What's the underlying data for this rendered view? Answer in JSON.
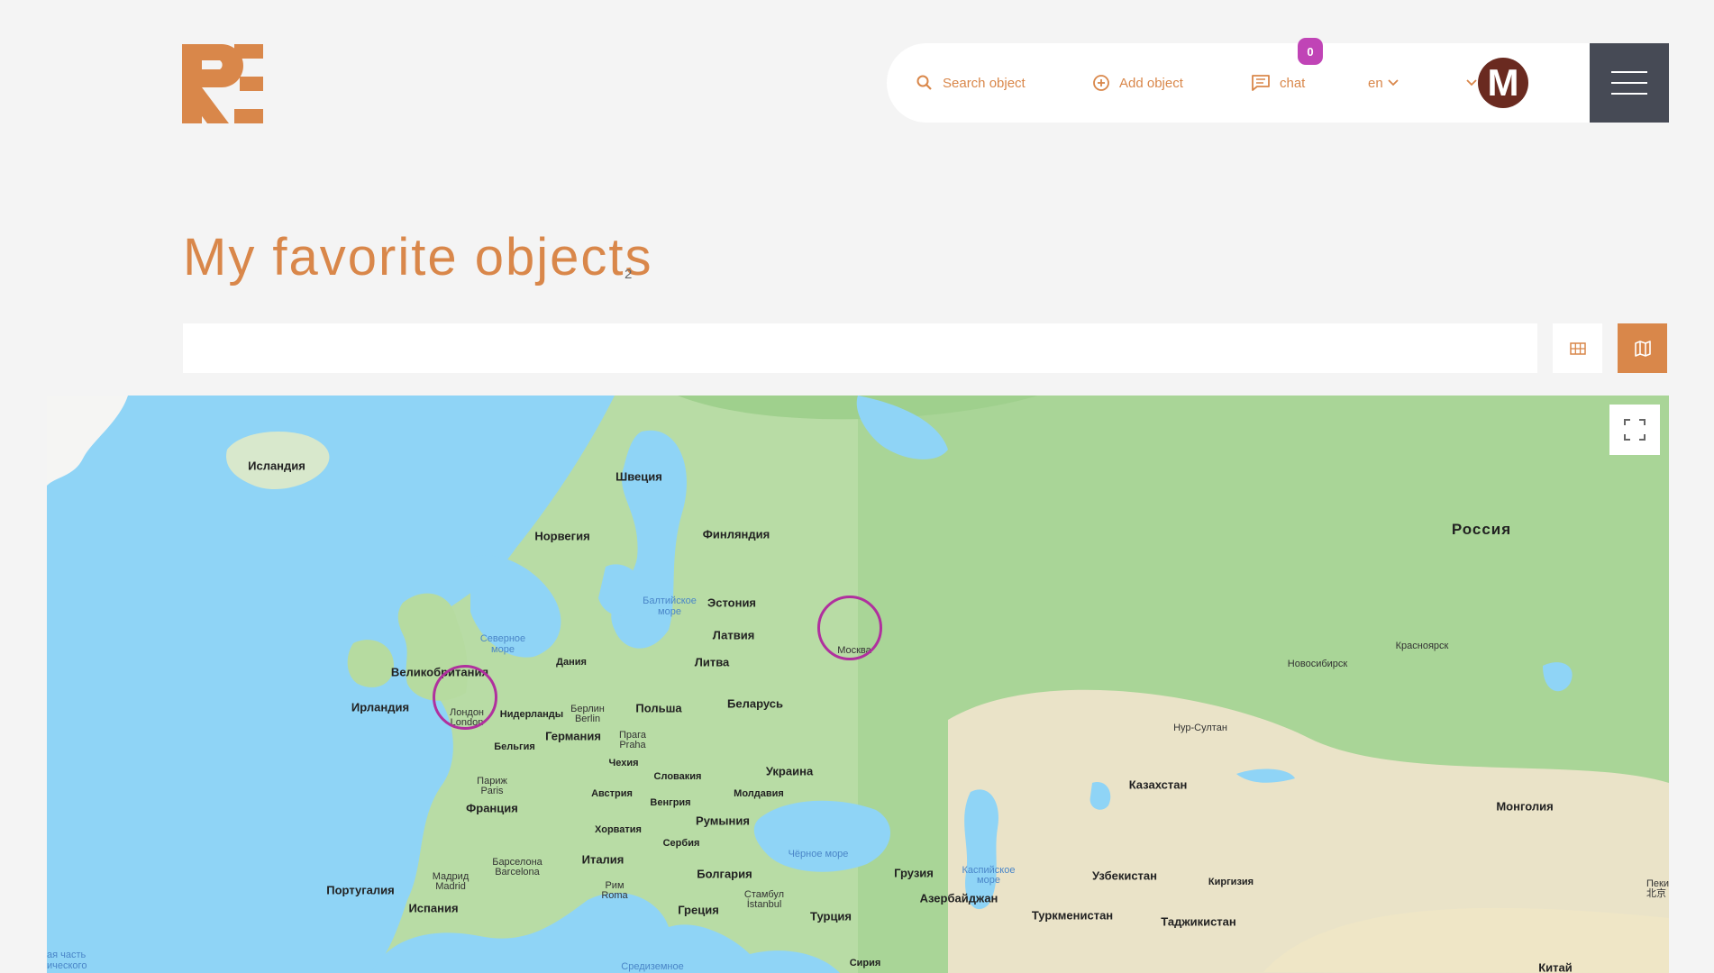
{
  "header": {
    "logo_alt": "RE",
    "nav": {
      "search_label": "Search object",
      "add_label": "Add object",
      "chat_label": "chat",
      "chat_badge": "0",
      "lang_label": "en",
      "avatar_letter": "M"
    }
  },
  "page": {
    "title": "My favorite objects",
    "count": "2"
  },
  "colors": {
    "accent": "#d9874a",
    "badge": "#c044b6",
    "menu_bg": "#464a55",
    "marker": "#b0309e"
  },
  "map": {
    "labels": {
      "iceland": "Исландия",
      "sweden": "Швеция",
      "norway": "Норвегия",
      "finland": "Финляндия",
      "russia": "Россия",
      "estonia": "Эстония",
      "baltic_sea": "Балтийское море",
      "north_sea": "Северное море",
      "latvia": "Латвия",
      "lithuania": "Литва",
      "denmark": "Дания",
      "uk": "Великобритания",
      "ireland": "Ирландия",
      "netherlands": "Нидерланды",
      "berlin": "Берлин Berlin",
      "poland": "Польша",
      "belarus": "Беларусь",
      "germany": "Германия",
      "belgium": "Бельгия",
      "prague": "Прага Praha",
      "czech": "Чехия",
      "paris": "Париж Paris",
      "slovakia": "Словакия",
      "ukraine": "Украина",
      "france": "Франция",
      "austria": "Австрия",
      "moldova": "Молдавия",
      "hungary": "Венгрия",
      "romania": "Румыния",
      "croatia": "Хорватия",
      "serbia": "Сербия",
      "black_sea": "Чёрное море",
      "barcelona": "Барселона Barcelona",
      "italy": "Италия",
      "bulgaria": "Болгария",
      "madrid": "Мадрид Madrid",
      "portugal": "Португалия",
      "spain": "Испания",
      "rome": "Рим Roma",
      "greece": "Греция",
      "istanbul": "Стамбул İstanbul",
      "turkey": "Турция",
      "georgia": "Грузия",
      "azerbaijan": "Азербайджан",
      "caspian": "Каспийское море",
      "uzbekistan": "Узбекистан",
      "kyrgyzstan": "Киргизия",
      "turkmenistan": "Туркменистан",
      "tajikistan": "Таджикистан",
      "kazakhstan": "Казахстан",
      "mongolia": "Монголия",
      "nursultan": "Нур-Султан",
      "novosibirsk": "Новосибирск",
      "krasnoyarsk": "Красноярск",
      "moscow": "Москва",
      "london": "Лондон London",
      "syria": "Сирия",
      "china": "Китай",
      "peking": "Пекин 北京",
      "mediterranean": "Средиземное",
      "atlantic": "ая часть ического"
    }
  }
}
